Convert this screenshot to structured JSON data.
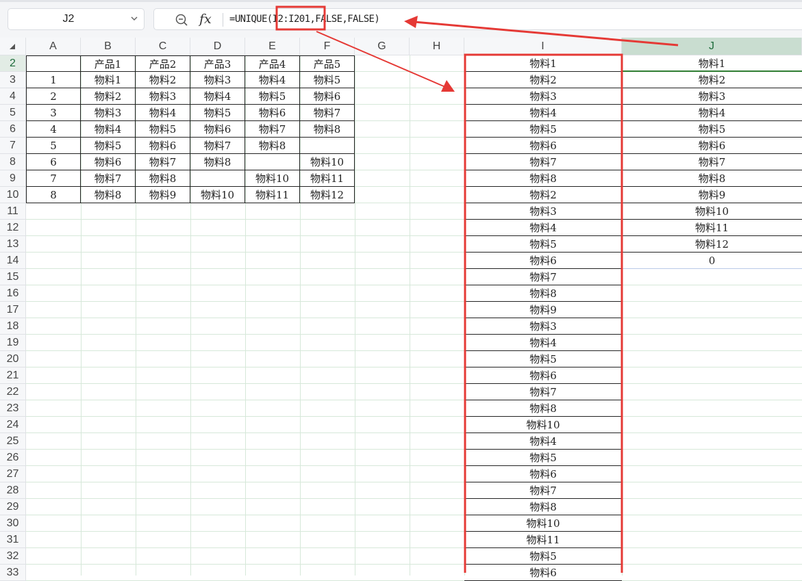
{
  "name_box": {
    "value": "J2"
  },
  "formula_bar": {
    "formula": "=UNIQUE(I2:I201,FALSE,FALSE)"
  },
  "columns": [
    "A",
    "B",
    "C",
    "D",
    "E",
    "F",
    "G",
    "H",
    "I",
    "J"
  ],
  "rows": [
    2,
    3,
    4,
    5,
    6,
    7,
    8,
    9,
    10,
    11,
    12,
    13,
    14,
    15,
    16,
    17,
    18,
    19,
    20,
    21,
    22,
    23,
    24,
    25,
    26,
    27,
    28,
    29,
    30,
    31,
    32,
    33
  ],
  "table": {
    "header": [
      "",
      "产品1",
      "产品2",
      "产品3",
      "产品4",
      "产品5"
    ],
    "body": [
      [
        "1",
        "物料1",
        "物料2",
        "物料3",
        "物料4",
        "物料5"
      ],
      [
        "2",
        "物料2",
        "物料3",
        "物料4",
        "物料5",
        "物料6"
      ],
      [
        "3",
        "物料3",
        "物料4",
        "物料5",
        "物料6",
        "物料7"
      ],
      [
        "4",
        "物料4",
        "物料5",
        "物料6",
        "物料7",
        "物料8"
      ],
      [
        "5",
        "物料5",
        "物料6",
        "物料7",
        "物料8",
        ""
      ],
      [
        "6",
        "物料6",
        "物料7",
        "物料8",
        "",
        "物料10"
      ],
      [
        "7",
        "物料7",
        "物料8",
        "",
        "物料10",
        "物料11"
      ],
      [
        "8",
        "物料8",
        "物料9",
        "物料10",
        "物料11",
        "物料12"
      ]
    ]
  },
  "column_I": [
    "物料1",
    "物料2",
    "物料3",
    "物料4",
    "物料5",
    "物料6",
    "物料7",
    "物料8",
    "物料2",
    "物料3",
    "物料4",
    "物料5",
    "物料6",
    "物料7",
    "物料8",
    "物料9",
    "物料3",
    "物料4",
    "物料5",
    "物料6",
    "物料7",
    "物料8",
    "物料10",
    "物料4",
    "物料5",
    "物料6",
    "物料7",
    "物料8",
    "物料10",
    "物料11",
    "物料5",
    "物料6"
  ],
  "column_J": [
    "物料1",
    "物料2",
    "物料3",
    "物料4",
    "物料5",
    "物料6",
    "物料7",
    "物料8",
    "物料9",
    "物料10",
    "物料11",
    "物料12",
    "0"
  ],
  "colors": {
    "annotation": "#e53935",
    "selection": "#2e7d32",
    "grid": "#d6e8d9"
  },
  "icons": {
    "zoom": "zoom-out-icon",
    "fx": "fx-icon",
    "dropdown": "chevron-down-icon"
  }
}
